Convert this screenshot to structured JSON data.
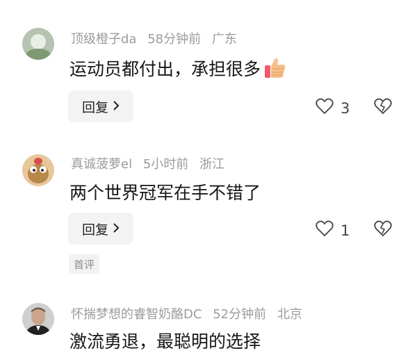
{
  "comments": [
    {
      "username": "顶级橙子da",
      "time": "58分钟前",
      "location": "广东",
      "text": "运动员都付出，承担很多",
      "reply_label": "回复",
      "likes": "3"
    },
    {
      "username": "真诚菠萝el",
      "time": "5小时前",
      "location": "浙江",
      "text": "两个世界冠军在手不错了",
      "reply_label": "回复",
      "likes": "1",
      "tag": "首评"
    },
    {
      "username": "怀揣梦想的睿智奶酪DC",
      "time": "52分钟前",
      "location": "北京",
      "text": "激流勇退，最聪明的选择"
    }
  ],
  "icons": {
    "like": "heart-outline-icon",
    "dislike": "broken-heart-icon",
    "reply_chevron": "chevron-right-icon",
    "emoji": "thumbs-up-emoji-icon"
  },
  "colors": {
    "meta": "#9b9b9b",
    "text": "#161616",
    "button_bg": "#f3f3f3"
  }
}
